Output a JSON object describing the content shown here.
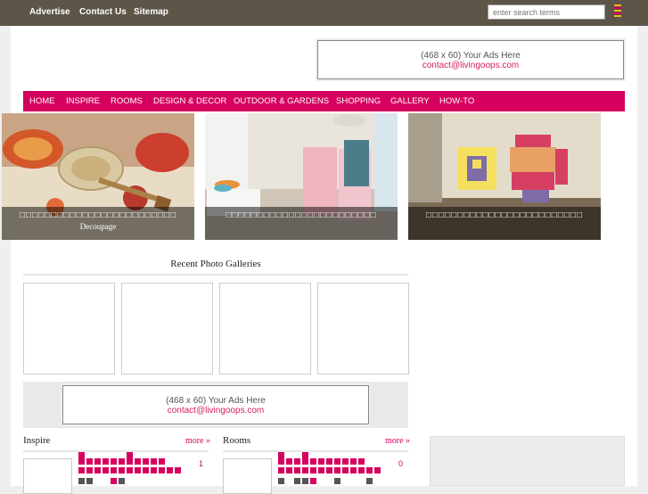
{
  "topbar": {
    "links": [
      "Advertise",
      "Contact Us",
      "Sitemap"
    ],
    "search_placeholder": "enter search terms"
  },
  "ads": [
    {
      "size": "(468 x 60) Your Ads Here",
      "email": "contact@livingoops.com"
    },
    {
      "size": "(468 x 60) Your Ads Here",
      "email": "contact@livingoops.com"
    }
  ],
  "nav": [
    "HOME",
    "INSPIRE",
    "ROOMS",
    "DESIGN & DECOR",
    "OUTDOOR & GARDENS",
    "SHOPPING",
    "GALLERY",
    "HOW-TO"
  ],
  "galleries": [
    {
      "caption": "□□□□□□□□□□□□□□□□□□□□□□□□□",
      "subtitle": "Decoupage"
    },
    {
      "caption": "□□□□□□□□□□□□□□□□□□□□□□□□",
      "subtitle": ""
    },
    {
      "caption": "□□□□□□□□□□□□□□□□□□□□□□□□□",
      "subtitle": ""
    }
  ],
  "recent": {
    "title": "Recent Photo Galleries"
  },
  "sections": [
    {
      "title": "Inspire",
      "more": "more »",
      "count": "1"
    },
    {
      "title": "Rooms",
      "more": "more »",
      "count": "0"
    }
  ],
  "colors": {
    "accent": "#d6005e",
    "topbar": "#5c5548"
  }
}
